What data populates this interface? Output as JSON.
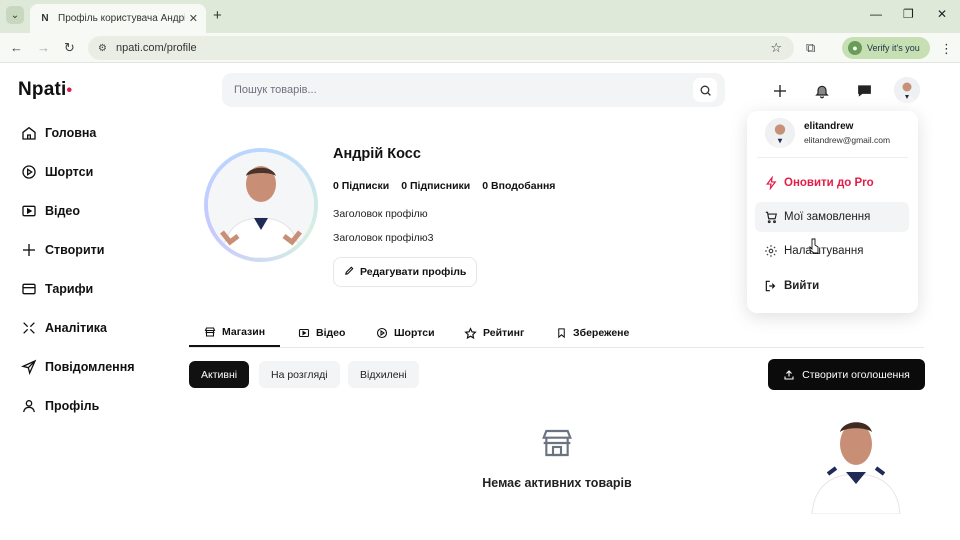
{
  "browser": {
    "tab_title": "Профіль користувача Андрій Косс",
    "tab_favicon": "N",
    "url": "npati.com/profile",
    "verify_label": "Verify it's you"
  },
  "header": {
    "logo": "Npati",
    "logo_dot": "•",
    "search_placeholder": "Пошук товарів...",
    "icons": [
      "plus-icon",
      "bell-icon",
      "chat-icon",
      "avatar"
    ]
  },
  "sidebar": {
    "items": [
      {
        "label": "Головна",
        "icon": "home-icon"
      },
      {
        "label": "Шортси",
        "icon": "play-icon"
      },
      {
        "label": "Відео",
        "icon": "video-icon"
      },
      {
        "label": "Створити",
        "icon": "plus-icon"
      },
      {
        "label": "Тарифи",
        "icon": "card-icon"
      },
      {
        "label": "Аналітика",
        "icon": "chart-icon"
      },
      {
        "label": "Повідомлення",
        "icon": "send-icon"
      },
      {
        "label": "Профіль",
        "icon": "user-icon"
      }
    ]
  },
  "profile": {
    "name": "Андрій Косс",
    "subscriptions": "0 Підписки",
    "subscribers": "0 Підписники",
    "likes": "0 Вподобання",
    "headline_1": "Заголовок профілю",
    "headline_2": "Заголовок профілю3",
    "edit_label": "Редагувати профіль"
  },
  "content_tabs": [
    {
      "label": "Магазин",
      "icon": "store-icon",
      "active": true
    },
    {
      "label": "Відео",
      "icon": "video-icon"
    },
    {
      "label": "Шортси",
      "icon": "play-icon"
    },
    {
      "label": "Рейтинг",
      "icon": "star-icon"
    },
    {
      "label": "Збережене",
      "icon": "bookmark-icon"
    }
  ],
  "filters": [
    {
      "label": "Активні",
      "active": true
    },
    {
      "label": "На розгляді"
    },
    {
      "label": "Відхилені"
    }
  ],
  "create_label": "Створити оголошення",
  "empty_text": "Немає активних товарів",
  "dropdown": {
    "username": "elitandrew",
    "email": "elitandrew@gmail.com",
    "items": [
      {
        "label": "Оновити до Pro",
        "icon": "lightning-icon"
      },
      {
        "label": "Мої замовлення",
        "icon": "cart-icon"
      },
      {
        "label": "Налаштування",
        "icon": "gear-icon"
      },
      {
        "label": "Вийти",
        "icon": "logout-icon"
      }
    ]
  },
  "colors": {
    "accent": "#e11d48",
    "dark_button": "#0b0b0b",
    "tabbar": "#dfe9d9"
  }
}
